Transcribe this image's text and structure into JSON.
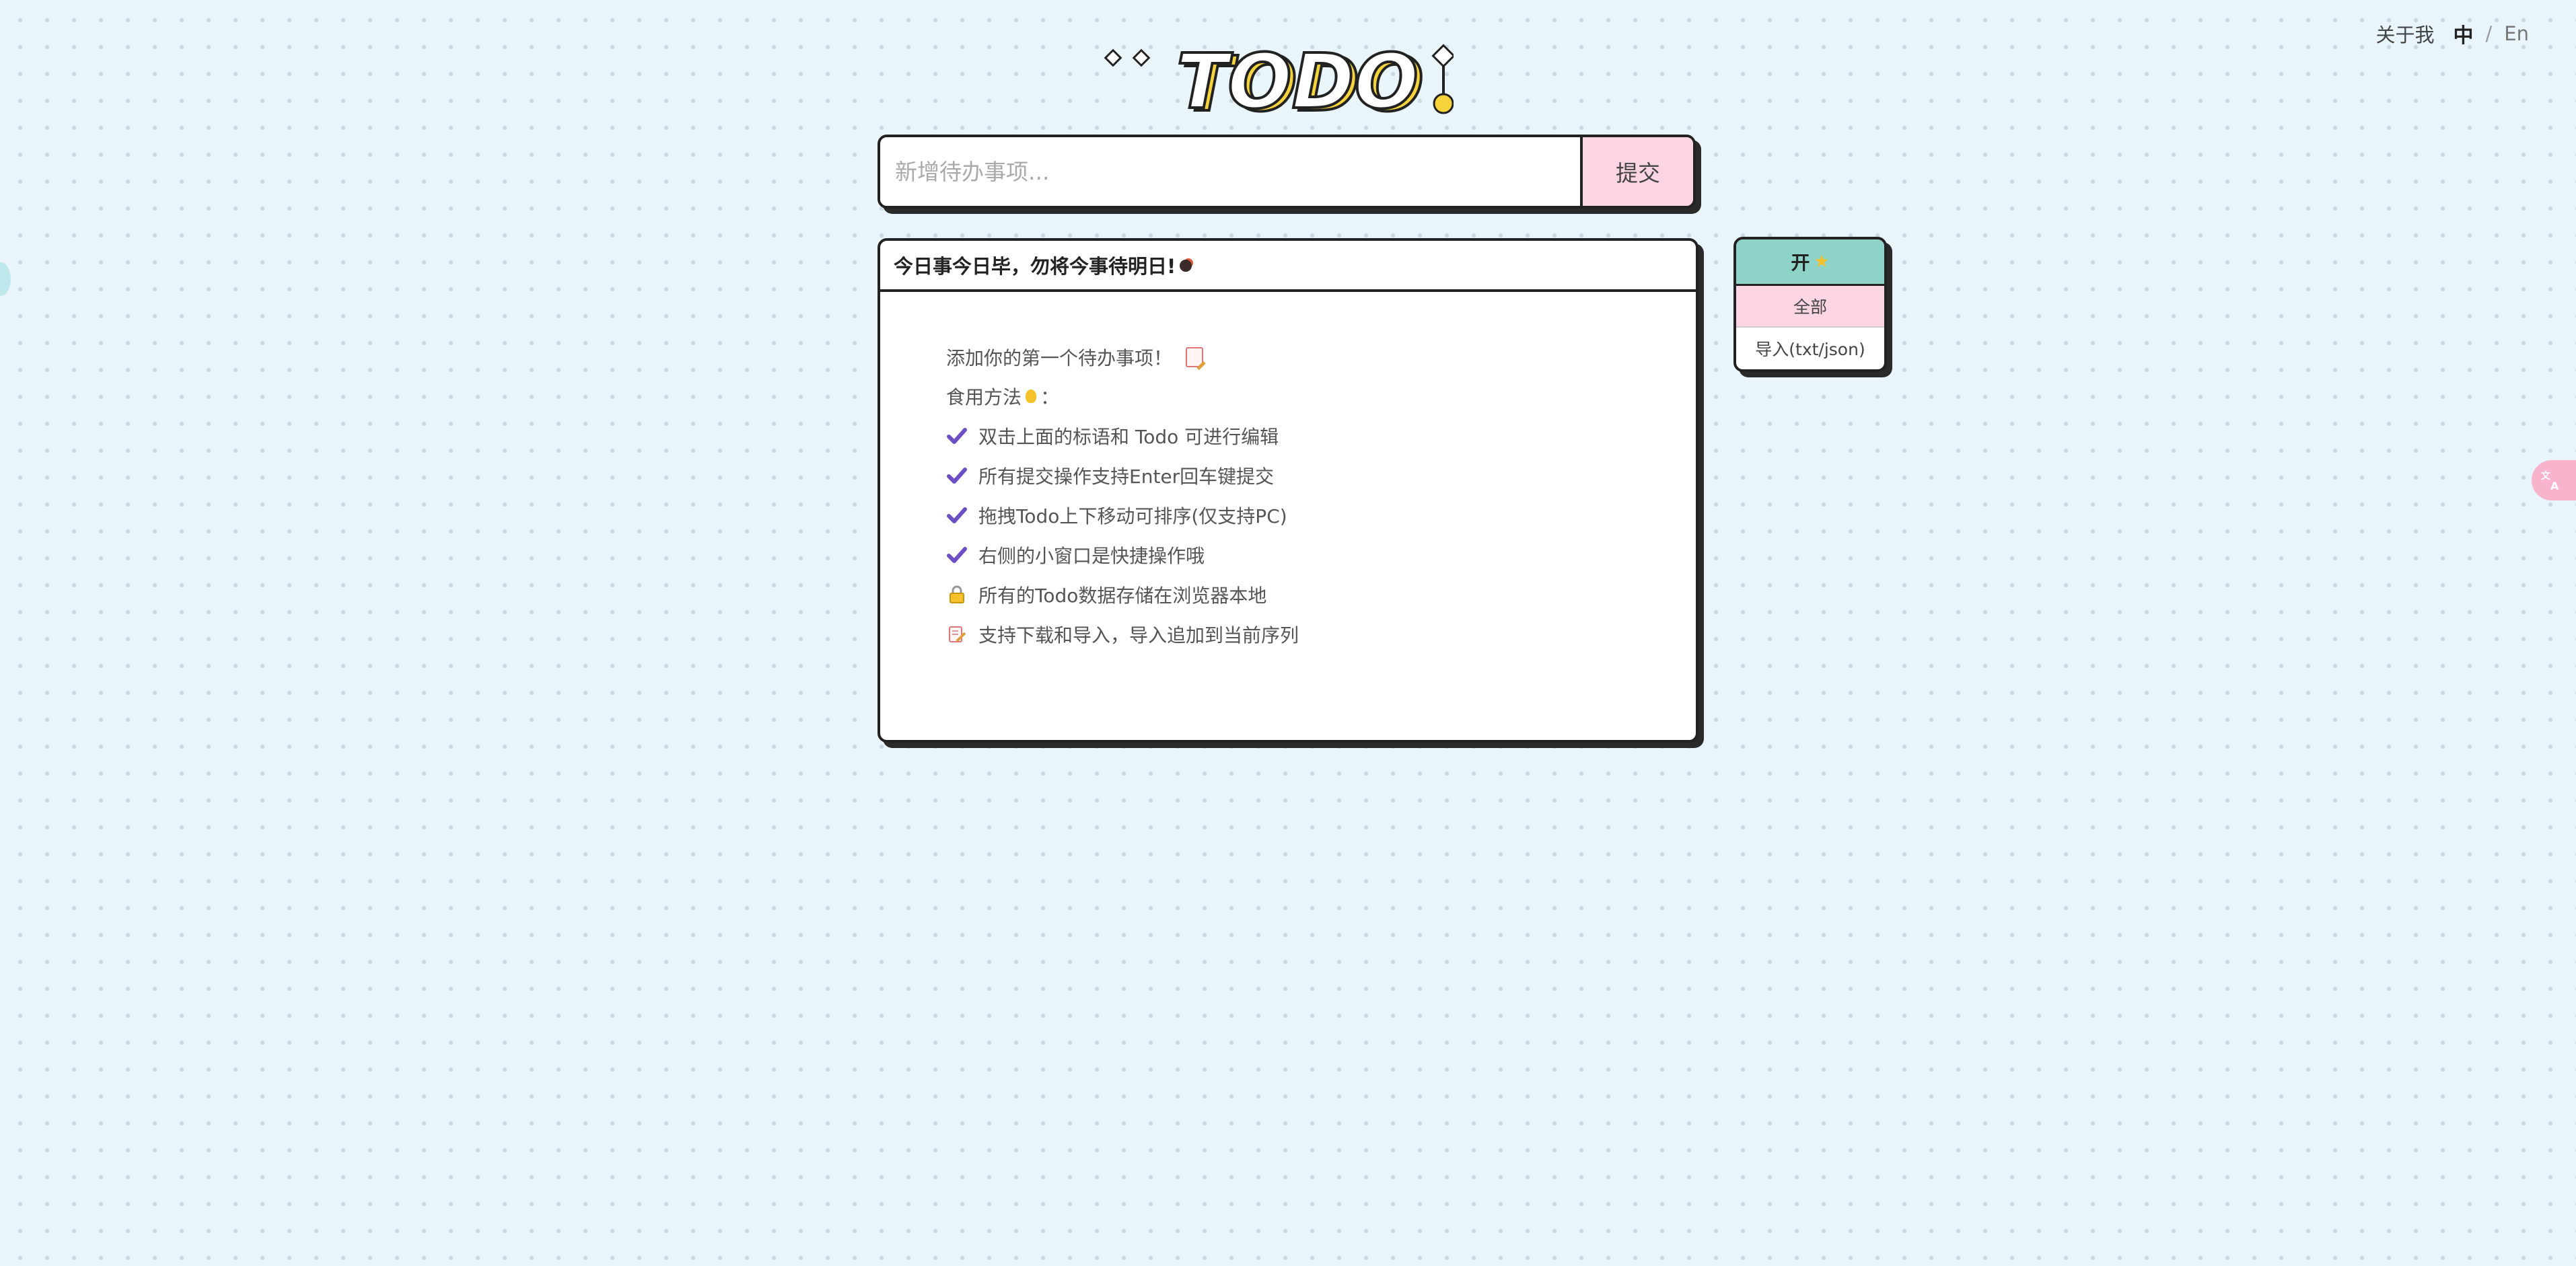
{
  "nav": {
    "about": "关于我",
    "lang_zh": "中",
    "lang_sep": "/",
    "lang_en": "En"
  },
  "logo": {
    "text": "TODO"
  },
  "input": {
    "placeholder": "新增待办事项...",
    "value": "",
    "submit_label": "提交"
  },
  "card": {
    "title": "今日事今日毕，勿将今事待明日!",
    "intro": "添加你的第一个待办事项！",
    "usage_label": "食用方法",
    "usage_colon": "：",
    "tips": [
      {
        "icon": "check-icon",
        "text": "双击上面的标语和 Todo 可进行编辑"
      },
      {
        "icon": "check-icon",
        "text": "所有提交操作支持Enter回车键提交"
      },
      {
        "icon": "check-icon",
        "text": "拖拽Todo上下移动可排序(仅支持PC)"
      },
      {
        "icon": "check-icon",
        "text": "右侧的小窗口是快捷操作哦"
      },
      {
        "icon": "lock-icon",
        "text": "所有的Todo数据存储在浏览器本地"
      },
      {
        "icon": "memo-icon",
        "text": "支持下载和导入，导入追加到当前序列"
      }
    ]
  },
  "side_panel": {
    "header": "开",
    "items": [
      {
        "label": "全部",
        "active": true
      },
      {
        "label": "导入(txt/json)",
        "active": false
      }
    ]
  },
  "translate_bubble": {
    "icon": "translate-icon"
  },
  "colors": {
    "background": "#e9f4fb",
    "accent_pink": "#fcd5e4",
    "accent_teal": "#8fd3c8",
    "check_purple": "#6c4fc4",
    "logo_yellow": "#f6d33c"
  }
}
